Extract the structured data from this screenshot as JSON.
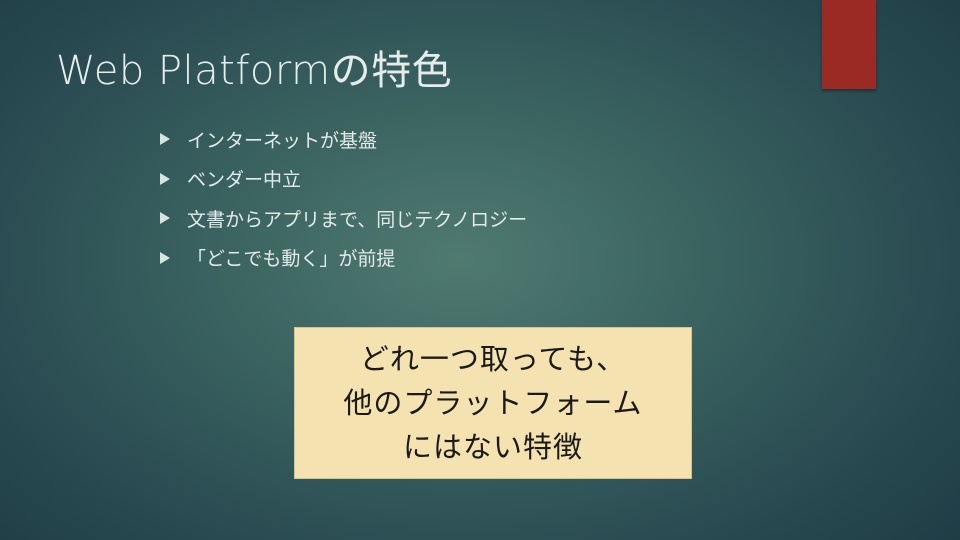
{
  "slide": {
    "title": "Web Platformの特色",
    "bullets": [
      "インターネットが基盤",
      "ベンダー中立",
      "文書からアプリまで、同じテクノロジー",
      "「どこでも動く」が前提"
    ],
    "callout": {
      "lines": [
        "どれ一つ取っても、",
        "他のプラットフォーム",
        "にはない特徴"
      ]
    }
  },
  "colors": {
    "background": "#3b6461",
    "accent_bar": "#9b2a22",
    "callout_fill": "#f4e3b0",
    "text_light": "#e3ebe8",
    "text_dark": "#1a1a1a"
  }
}
